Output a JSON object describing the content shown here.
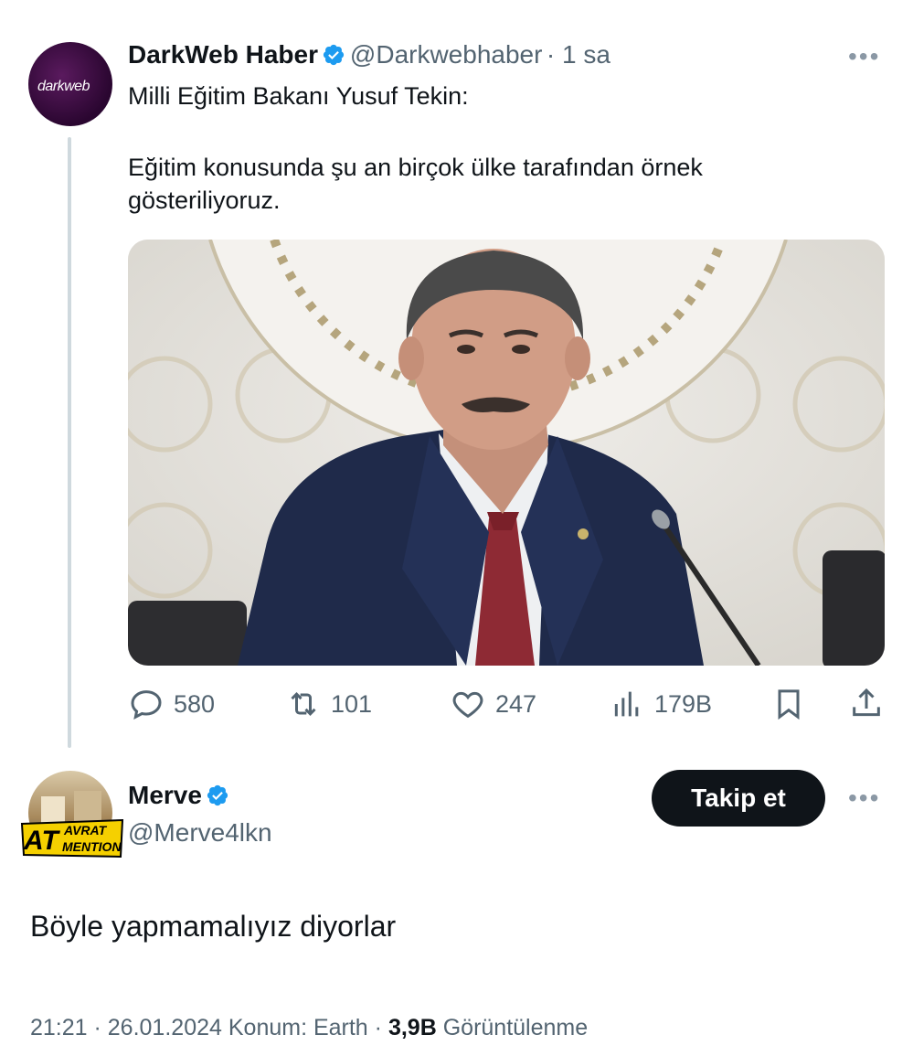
{
  "tweet": {
    "author_name": "DarkWeb Haber",
    "author_handle": "@Darkwebhaber",
    "time": "· 1 sa",
    "avatar_text": "darkweb",
    "text_line1": "Milli Eğitim Bakanı Yusuf Tekin:",
    "text_line2": "Eğitim konusunda şu an birçok ülke tarafından örnek",
    "text_line3": "gösteriliyoruz.",
    "more_icon": "more-horizontal-icon",
    "verified_icon": "verified-badge-icon",
    "image_alt": "Man in navy suit and red tie speaking at a microphone"
  },
  "actions": {
    "replies": "580",
    "retweets": "101",
    "likes": "247",
    "views": "179B"
  },
  "reply": {
    "author_name": "Merve",
    "author_handle": "@Merve4lkn",
    "follow_label": "Takip et",
    "text": "Böyle yapmamalıyız diyorlar",
    "sticker_line1": "AVRAT",
    "sticker_line2": "MENTION",
    "sticker_big": "AT"
  },
  "meta": {
    "time_date": "21:21 · 26.01.2024",
    "location": "Konum: Earth ·",
    "views_count": "3,9B",
    "views_label": "Görüntülenme"
  },
  "colors": {
    "verified": "#1d9bf0",
    "text_primary": "#0f1419",
    "text_secondary": "#536471",
    "button_bg": "#0f1419"
  }
}
